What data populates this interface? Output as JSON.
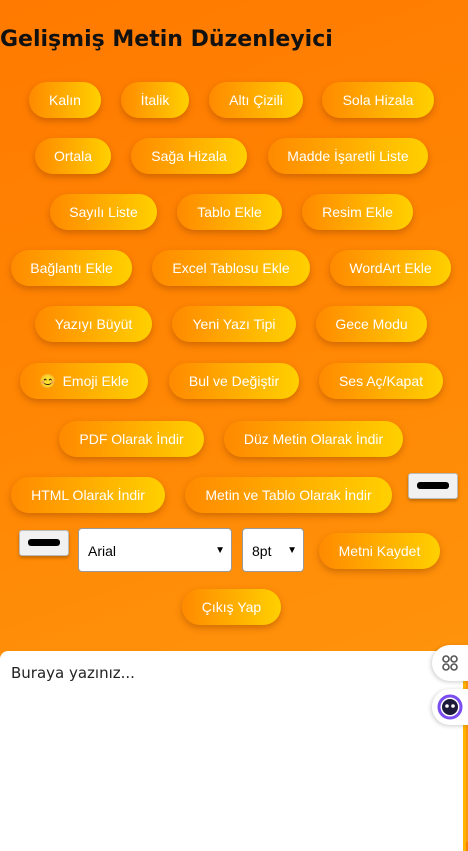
{
  "title": "Gelişmiş Metin Düzenleyici",
  "buttons": {
    "bold": "Kalın",
    "italic": "İtalik",
    "underline": "Altı Çizili",
    "align_left": "Sola Hizala",
    "center": "Ortala",
    "align_right": "Sağa Hizala",
    "bullet_list": "Madde İşaretli Liste",
    "numbered_list": "Sayılı Liste",
    "insert_table": "Tablo Ekle",
    "insert_image": "Resim Ekle",
    "insert_link": "Bağlantı Ekle",
    "insert_excel": "Excel Tablosu Ekle",
    "insert_wordart": "WordArt Ekle",
    "enlarge_text": "Yazıyı Büyüt",
    "new_font": "Yeni Yazı Tipi",
    "night_mode": "Gece Modu",
    "emoji": "Emoji Ekle",
    "find_replace": "Bul ve Değiştir",
    "sound_toggle": "Ses Aç/Kapat",
    "download_pdf": "PDF Olarak İndir",
    "download_txt": "Düz Metin Olarak İndir",
    "download_html": "HTML Olarak İndir",
    "download_text_table": "Metin ve Tablo Olarak İndir",
    "save": "Metni Kaydet",
    "logout": "Çıkış Yap"
  },
  "font_select": {
    "value": "Arial"
  },
  "size_select": {
    "value": "8pt"
  },
  "editor": {
    "placeholder": "Buraya yazınız..."
  },
  "icons": {
    "emoji": "😊"
  },
  "colors": {
    "accent_start": "#ff8a00",
    "accent_end": "#ffd000",
    "background": "#ff7a00"
  }
}
